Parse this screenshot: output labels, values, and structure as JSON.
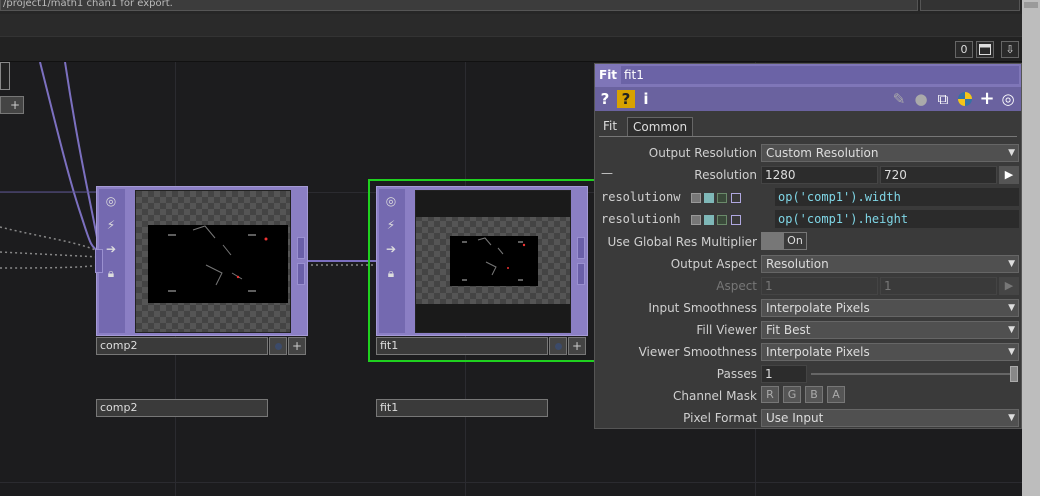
{
  "top_field_text": "/project1/math1 chan1 for export.",
  "toolbar": {
    "zero_label": "0",
    "window_icon": "window-icon",
    "pin_icon": "pin-icon"
  },
  "nodes": [
    {
      "name": "comp2"
    },
    {
      "name": "fit1"
    }
  ],
  "panel": {
    "type_label": "Fit",
    "node_name": "fit1",
    "icons": [
      "help-icon",
      "op-help-icon",
      "info-icon",
      "edit-icon",
      "comment-icon",
      "clone-icon",
      "python-icon",
      "add-icon",
      "target-icon"
    ],
    "tabs": [
      "Fit",
      "Common"
    ],
    "active_tab": "Common",
    "params": {
      "output_resolution": {
        "label": "Output Resolution",
        "value": "Custom Resolution"
      },
      "resolution": {
        "label": "Resolution",
        "w": "1280",
        "h": "720"
      },
      "resolutionw": {
        "label": "resolutionw",
        "expr": "op('comp1').width"
      },
      "resolutionh": {
        "label": "resolutionh",
        "expr": "op('comp1').height"
      },
      "global_res": {
        "label": "Use Global Res Multiplier",
        "value": "On"
      },
      "output_aspect": {
        "label": "Output Aspect",
        "value": "Resolution"
      },
      "aspect": {
        "label": "Aspect",
        "v1": "1",
        "v2": "1"
      },
      "input_smoothness": {
        "label": "Input Smoothness",
        "value": "Interpolate Pixels"
      },
      "fill_viewer": {
        "label": "Fill Viewer",
        "value": "Fit Best"
      },
      "viewer_smoothness": {
        "label": "Viewer Smoothness",
        "value": "Interpolate Pixels"
      },
      "passes": {
        "label": "Passes",
        "value": "1"
      },
      "channel_mask": {
        "label": "Channel Mask",
        "channels": [
          "R",
          "G",
          "B",
          "A"
        ]
      },
      "pixel_format": {
        "label": "Pixel Format",
        "value": "Use Input"
      }
    }
  },
  "colors": {
    "operator_purple": "#8b7fc4",
    "selection_green": "#1fd01f",
    "expression_cyan": "#7fd6e6"
  }
}
